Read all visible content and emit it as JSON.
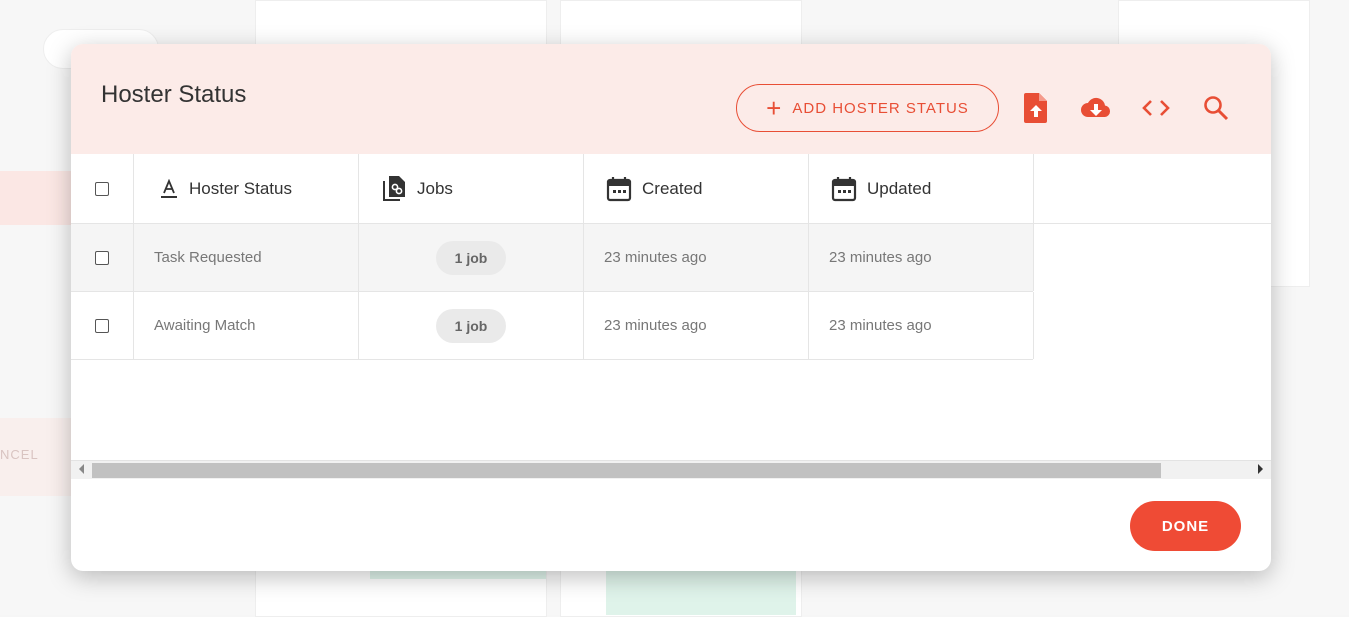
{
  "modal": {
    "title": "Hoster Status",
    "add_button_label": "ADD HOSTER STATUS",
    "done_button_label": "DONE"
  },
  "table": {
    "columns": [
      {
        "label": "Hoster Status",
        "icon": "text-format-icon"
      },
      {
        "label": "Jobs",
        "icon": "linked-files-icon"
      },
      {
        "label": "Created",
        "icon": "calendar-icon"
      },
      {
        "label": "Updated",
        "icon": "calendar-icon"
      }
    ],
    "rows": [
      {
        "status": "Task Requested",
        "jobs": "1 job",
        "created": "23 minutes ago",
        "updated": "23 minutes ago"
      },
      {
        "status": "Awaiting Match",
        "jobs": "1 job",
        "created": "23 minutes ago",
        "updated": "23 minutes ago"
      }
    ]
  },
  "background": {
    "cancel_fragment": "NCEL"
  },
  "colors": {
    "accent": "#ef4b35",
    "header_bg": "#fcebe8"
  }
}
